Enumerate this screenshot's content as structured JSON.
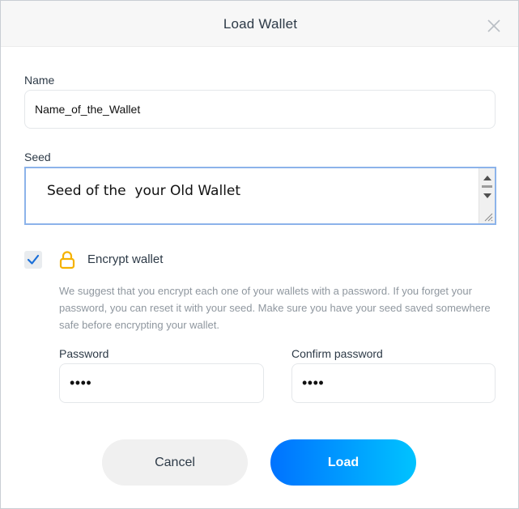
{
  "dialog": {
    "title": "Load Wallet",
    "close_icon": "close-icon"
  },
  "name_field": {
    "label": "Name",
    "value": "Name_of_the_Wallet"
  },
  "seed_field": {
    "label": "Seed",
    "value": "Seed of the  your Old Wallet"
  },
  "encrypt": {
    "checked": true,
    "label": "Encrypt wallet",
    "icon": "lock-icon",
    "hint": "We suggest that you encrypt each one of your wallets with a password. If you forget your password, you can reset it with your seed. Make sure you have your seed saved somewhere safe before encrypting your wallet."
  },
  "password": {
    "label": "Password",
    "value": "••••"
  },
  "confirm_password": {
    "label": "Confirm password",
    "value": "••••"
  },
  "buttons": {
    "cancel": "Cancel",
    "load": "Load"
  },
  "colors": {
    "accent_start": "#0072ff",
    "accent_end": "#00c3ff",
    "checkmark": "#1a6fd8",
    "lock": "#f5b200"
  }
}
